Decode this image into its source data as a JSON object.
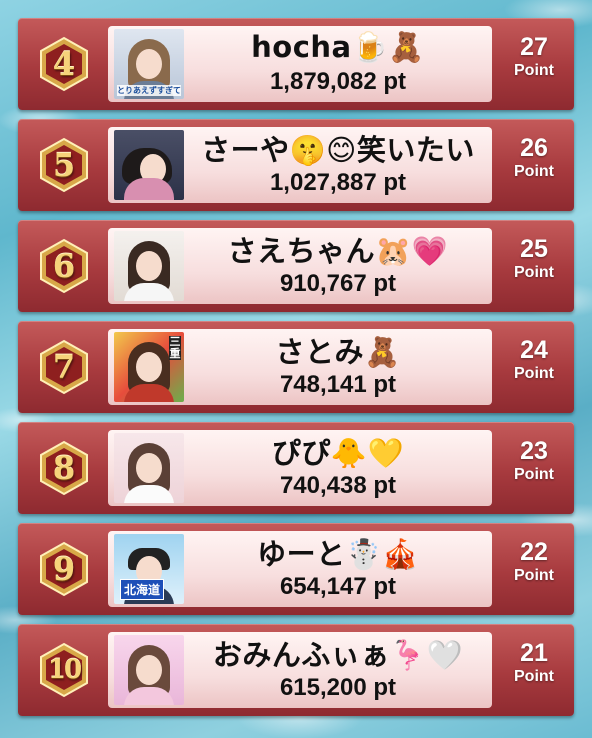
{
  "ranking": [
    {
      "rank": "4",
      "name": "hocha🍺🧸",
      "score": "1,879,082 pt",
      "points": "27",
      "points_unit": "Point",
      "avatar_caption": "とりあえずすぎて!"
    },
    {
      "rank": "5",
      "name": "さーや🤫😊笑いたい",
      "score": "1,027,887 pt",
      "points": "26",
      "points_unit": "Point"
    },
    {
      "rank": "6",
      "name": "さえちゃん🐹💗",
      "score": "910,767 pt",
      "points": "25",
      "points_unit": "Point"
    },
    {
      "rank": "7",
      "name": "さとみ🧸",
      "score": "748,141 pt",
      "points": "24",
      "points_unit": "Point",
      "avatar_caption": "三重"
    },
    {
      "rank": "8",
      "name": "ぴぴ🐥💛",
      "score": "740,438 pt",
      "points": "23",
      "points_unit": "Point"
    },
    {
      "rank": "9",
      "name": "ゆーと☃️🎪",
      "score": "654,147 pt",
      "points": "22",
      "points_unit": "Point",
      "avatar_caption": "北海道"
    },
    {
      "rank": "10",
      "name": "おみんふぃぁ🦩🤍",
      "score": "615,200 pt",
      "points": "21",
      "points_unit": "Point"
    }
  ],
  "colors": {
    "row_red": "#a73a3e",
    "panel_pink": "#f7dede",
    "gold": "#f6d37a",
    "badge_red": "#8e1f1f"
  }
}
